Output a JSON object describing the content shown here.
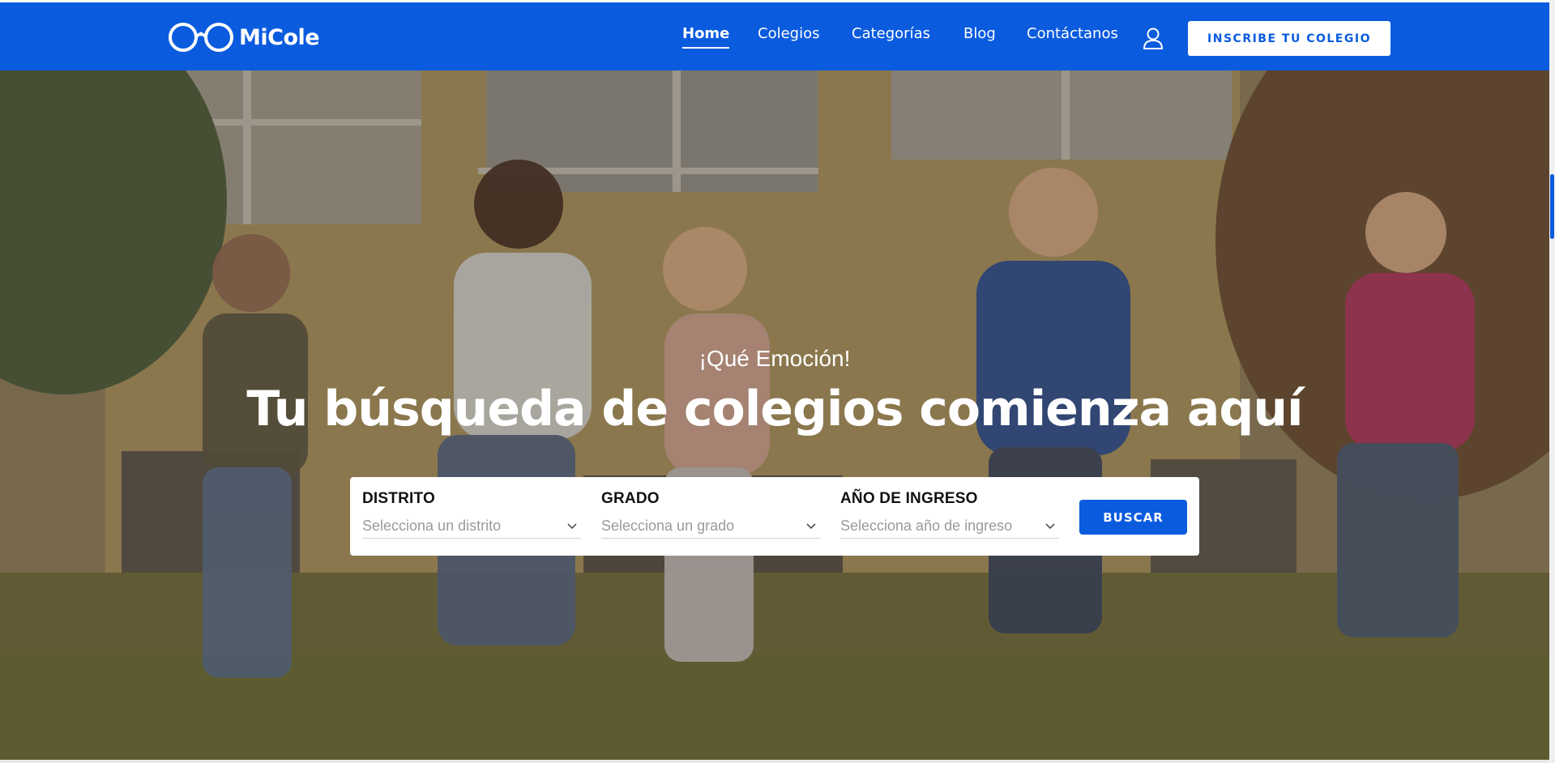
{
  "brand": {
    "name": "MiCole",
    "accent": "#0a5bde"
  },
  "nav": {
    "items": [
      {
        "label": "Home",
        "active": true
      },
      {
        "label": "Colegios"
      },
      {
        "label": "Categorías"
      },
      {
        "label": "Blog"
      },
      {
        "label": "Contáctanos"
      }
    ],
    "user_icon": "user-icon",
    "cta_label": "INSCRIBE TU COLEGIO"
  },
  "hero": {
    "eyebrow": "¡Qué Emoción!",
    "headline": "Tu búsqueda de colegios comienza aquí",
    "search": {
      "fields": [
        {
          "label": "DISTRITO",
          "placeholder": "Selecciona un distrito"
        },
        {
          "label": "GRADO",
          "placeholder": "Selecciona un grado"
        },
        {
          "label": "AÑO DE INGRESO",
          "placeholder": "Selecciona año de ingreso"
        }
      ],
      "button_label": "BUSCAR"
    }
  }
}
